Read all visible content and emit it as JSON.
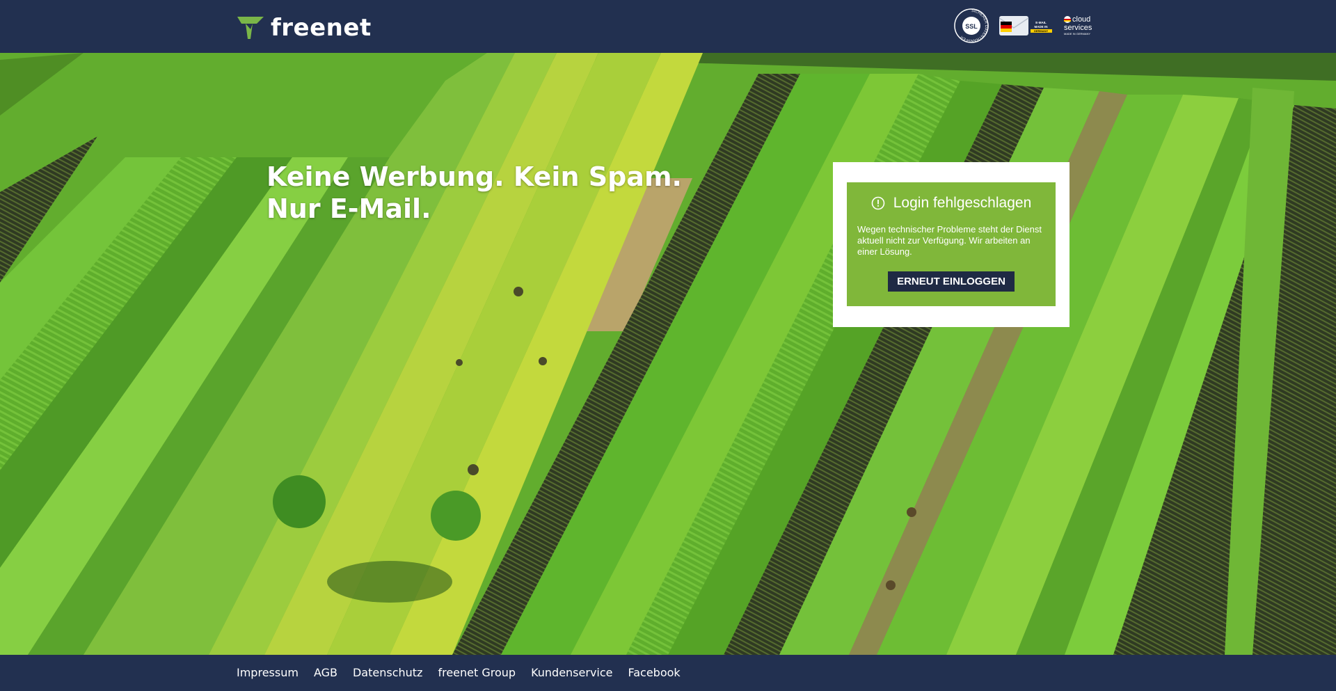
{
  "header": {
    "logo_text": "freenet",
    "badges": [
      {
        "icon": "ssl-seal-icon",
        "label": "SSL",
        "ring_text": "SICHERER DATENTRANSFER"
      },
      {
        "icon": "email-made-in-germany-icon",
        "label": "E-MAIL MADE IN GERMANY"
      },
      {
        "icon": "cloud-services-icon",
        "label_top": "cloud",
        "label_bottom": "services",
        "sub": "MADE IN GERMANY"
      }
    ]
  },
  "hero": {
    "headline_line1": "Keine Werbung. Kein Spam.",
    "headline_line2": "Nur E-Mail."
  },
  "login_error": {
    "icon": "info-circle-icon",
    "title": "Login fehlgeschlagen",
    "message": "Wegen technischer Probleme steht der Dienst aktuell nicht zur Verfügung. Wir arbeiten an einer Lösung.",
    "button_label": "ERNEUT EINLOGGEN"
  },
  "footer": {
    "links": [
      "Impressum",
      "AGB",
      "Datenschutz",
      "freenet Group",
      "Kundenservice",
      "Facebook"
    ]
  },
  "colors": {
    "nav_bg": "#223050",
    "card_green": "#80b73a",
    "button_bg": "#1f2a44",
    "logo_green": "#7ab648"
  }
}
